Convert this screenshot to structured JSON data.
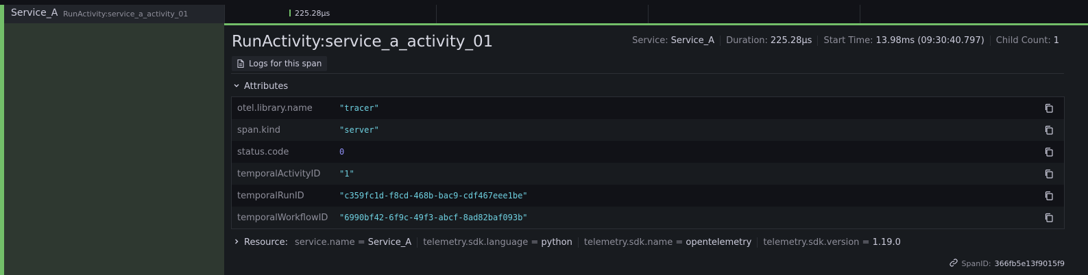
{
  "span_row": {
    "service_name": "Service_A",
    "operation_name": "RunActivity:service_a_activity_01",
    "duration": "225.28μs"
  },
  "detail": {
    "title": "RunActivity:service_a_activity_01",
    "logs_button_label": "Logs for this span",
    "meta": [
      {
        "key": "Service:",
        "value": "Service_A"
      },
      {
        "key": "Duration:",
        "value": "225.28μs"
      },
      {
        "key": "Start Time:",
        "value": "13.98ms (09:30:40.797)"
      },
      {
        "key": "Child Count:",
        "value": "1"
      }
    ],
    "attributes_label": "Attributes",
    "attributes": [
      {
        "key": "otel.library.name",
        "value": "\"tracer\""
      },
      {
        "key": "span.kind",
        "value": "\"server\""
      },
      {
        "key": "status.code",
        "value": "0"
      },
      {
        "key": "temporalActivityID",
        "value": "\"1\""
      },
      {
        "key": "temporalRunID",
        "value": "\"c359fc1d-f8cd-468b-bac9-cdf467eee1be\""
      },
      {
        "key": "temporalWorkflowID",
        "value": "\"6990bf42-6f9c-49f3-abcf-8ad82baf093b\""
      }
    ],
    "resource_label": "Resource:",
    "resources": [
      {
        "key": "service.name",
        "value": "Service_A"
      },
      {
        "key": "telemetry.sdk.language",
        "value": "python"
      },
      {
        "key": "telemetry.sdk.name",
        "value": "opentelemetry"
      },
      {
        "key": "telemetry.sdk.version",
        "value": "1.19.0"
      }
    ],
    "span_id_label": "SpanID:",
    "span_id": "366fb5e13f9015f9"
  },
  "colors": {
    "accent_green": "#73bf69",
    "string_value": "#6ed0e0",
    "number_value": "#8f8ff5"
  },
  "icons": [
    "file-text-icon",
    "chevron-down-icon",
    "chevron-right-icon",
    "copy-icon",
    "link-icon"
  ]
}
